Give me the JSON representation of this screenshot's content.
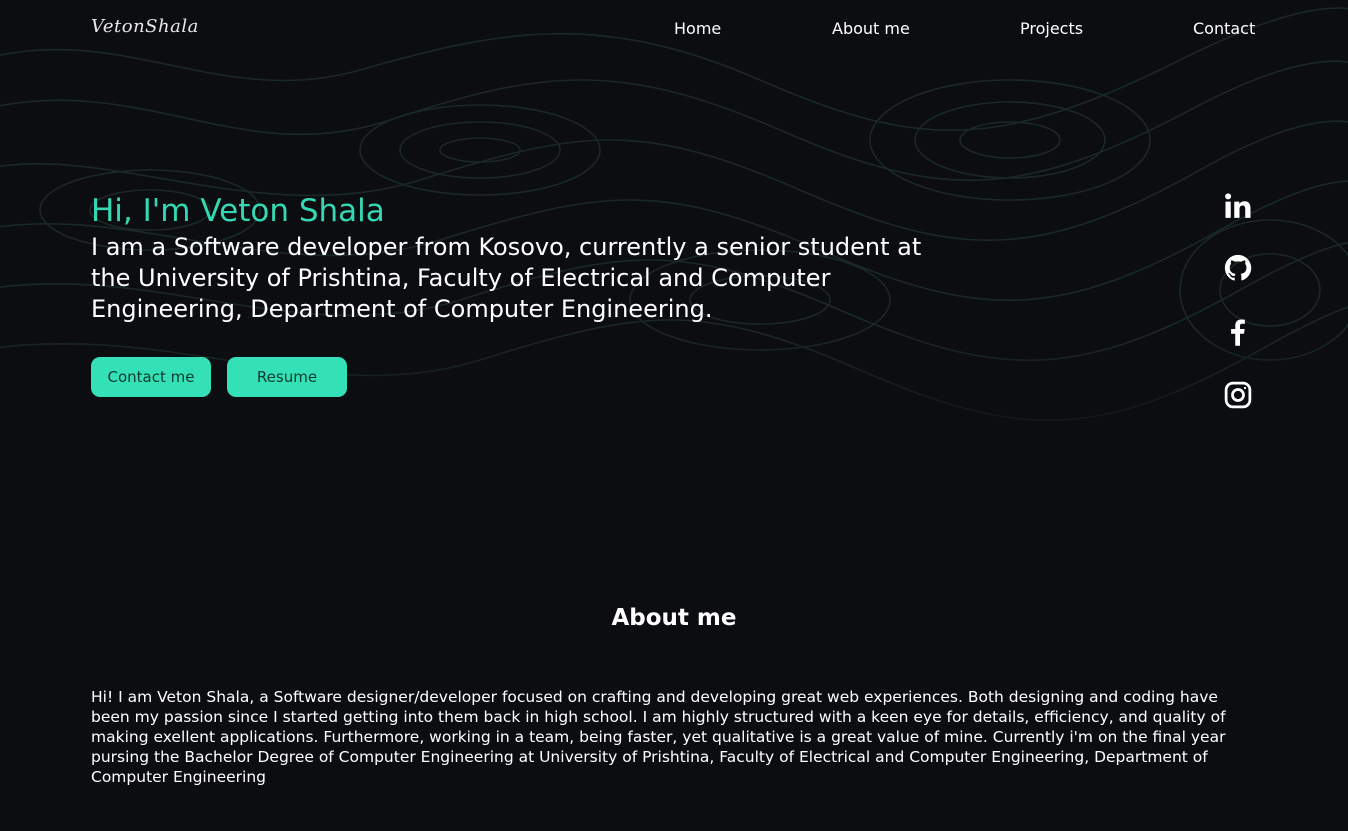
{
  "brand": {
    "logo_text": "VetonShala"
  },
  "nav": {
    "items": [
      {
        "label": "Home"
      },
      {
        "label": "About me"
      },
      {
        "label": "Projects"
      },
      {
        "label": "Contact"
      }
    ]
  },
  "hero": {
    "greeting": "Hi, I'm Veton Shala",
    "description": "I am a Software developer from Kosovo, currently a senior student at the University of Prishtina, Faculty of Electrical and Computer Engineering, Department of Computer Engineering.",
    "buttons": {
      "contact_label": "Contact me",
      "resume_label": "Resume"
    }
  },
  "social": {
    "icons": [
      "linkedin-icon",
      "github-icon",
      "facebook-icon",
      "instagram-icon"
    ]
  },
  "about": {
    "title": "About me",
    "text": "Hi! I am Veton Shala, a Software designer/developer focused on crafting and developing great web experiences. Both designing and coding have been my passion since I started getting into them back in high school. I am highly structured with a keen eye for details, efficiency, and quality of making exellent applications. Furthermore, working in a team, being faster, yet qualitative is a great value of mine. Currently i'm on the final year pursing the Bachelor Degree of Computer Engineering at University of Prishtina, Faculty of Electrical and Computer Engineering, Department of Computer Engineering"
  },
  "colors": {
    "background": "#0b0d11",
    "accent": "#34d9b3",
    "button": "#34e0b5",
    "button_text": "#0f3a30",
    "topo_lines": "#1c2a28"
  }
}
